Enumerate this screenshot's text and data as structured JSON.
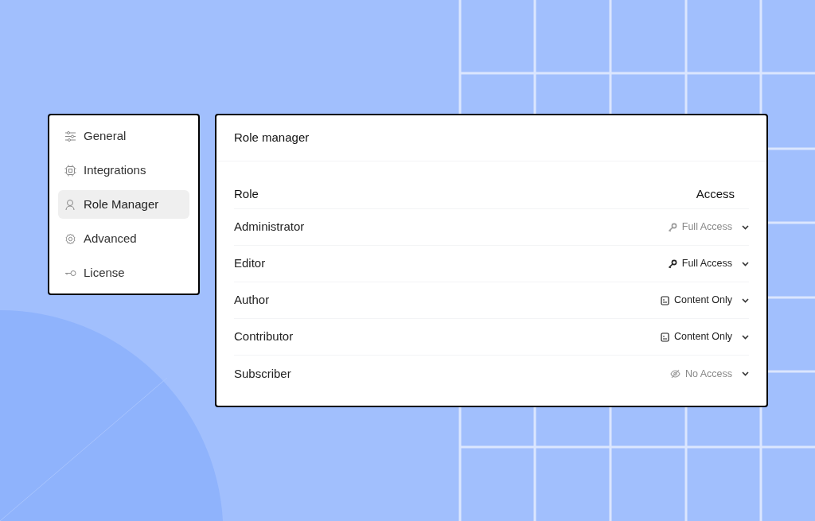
{
  "sidebar": {
    "items": [
      {
        "label": "General",
        "selected": false
      },
      {
        "label": "Integrations",
        "selected": false
      },
      {
        "label": "Role Manager",
        "selected": true
      },
      {
        "label": "Advanced",
        "selected": false
      },
      {
        "label": "License",
        "selected": false
      }
    ]
  },
  "panel": {
    "title": "Role manager",
    "columns": [
      "Role",
      "Access"
    ],
    "rows": [
      {
        "role": "Administrator",
        "access": "Full Access",
        "kind": "full",
        "disabled": true
      },
      {
        "role": "Editor",
        "access": "Full Access",
        "kind": "full",
        "disabled": false
      },
      {
        "role": "Author",
        "access": "Content Only",
        "kind": "content",
        "disabled": false
      },
      {
        "role": "Contributor",
        "access": "Content Only",
        "kind": "content",
        "disabled": false
      },
      {
        "role": "Subscriber",
        "access": "No Access",
        "kind": "none",
        "disabled": true
      }
    ]
  }
}
